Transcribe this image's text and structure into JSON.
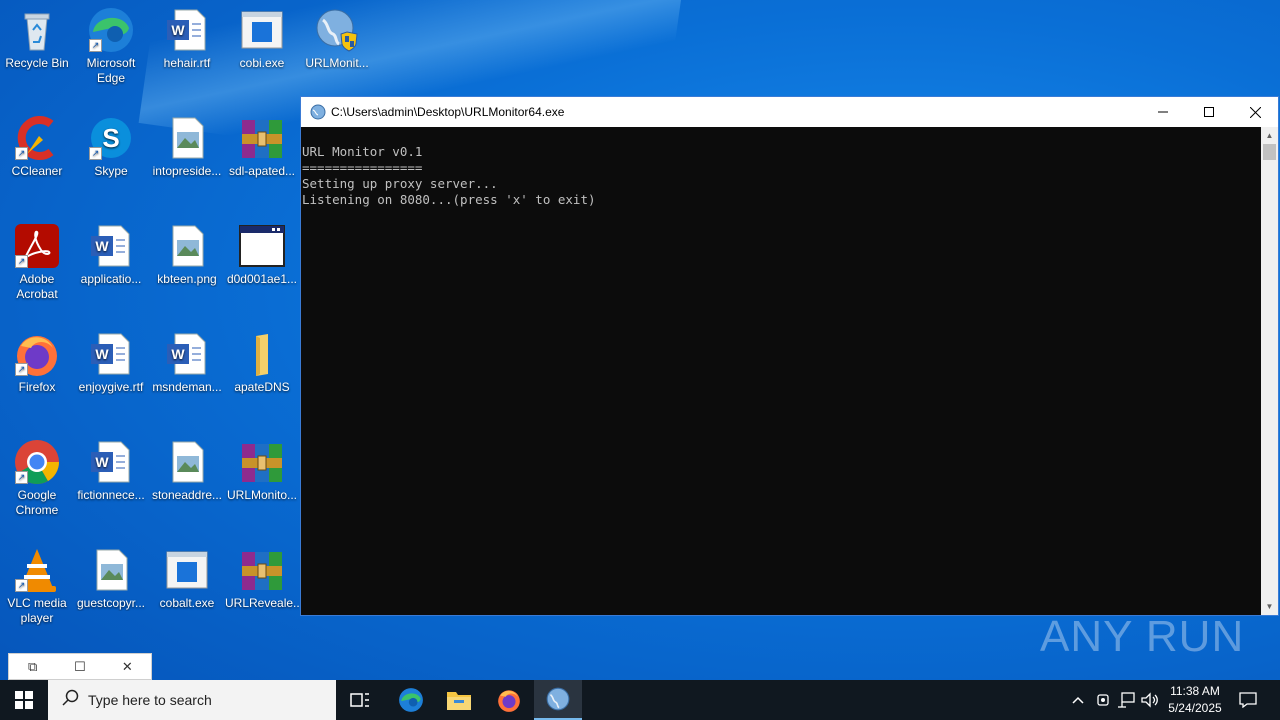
{
  "desktop": {
    "icons": [
      {
        "label": "Recycle Bin"
      },
      {
        "label": "Microsoft Edge"
      },
      {
        "label": "hehair.rtf"
      },
      {
        "label": "cobi.exe"
      },
      {
        "label": "URLMonit..."
      },
      {
        "label": "CCleaner"
      },
      {
        "label": "Skype"
      },
      {
        "label": "intopreside..."
      },
      {
        "label": "sdl-apated..."
      },
      {
        "label": "Adobe Acrobat"
      },
      {
        "label": "applicatio..."
      },
      {
        "label": "kbteen.png"
      },
      {
        "label": "d0d001ae1..."
      },
      {
        "label": "Firefox"
      },
      {
        "label": "enjoygive.rtf"
      },
      {
        "label": "msndeman..."
      },
      {
        "label": "apateDNS"
      },
      {
        "label": "Google Chrome"
      },
      {
        "label": "fictionnece..."
      },
      {
        "label": "stoneaddre..."
      },
      {
        "label": "URLMonito..."
      },
      {
        "label": "VLC media player"
      },
      {
        "label": "guestcopyr..."
      },
      {
        "label": "cobalt.exe"
      },
      {
        "label": "URLReveale..."
      }
    ]
  },
  "console": {
    "title": "C:\\Users\\admin\\Desktop\\URLMonitor64.exe",
    "lines": [
      "URL Monitor v0.1",
      "================",
      "Setting up proxy server...",
      "Listening on 8080...(press 'x' to exit)"
    ]
  },
  "watermark": "ANY RUN",
  "taskbar": {
    "search_placeholder": "Type here to search",
    "time": "11:38 AM",
    "date": "5/24/2025"
  },
  "colors": {
    "desktop_bg": "#0a6fd6",
    "console_bg": "#0c0c0c",
    "console_text": "#c0c0c0",
    "taskbar_bg": "#101820"
  }
}
